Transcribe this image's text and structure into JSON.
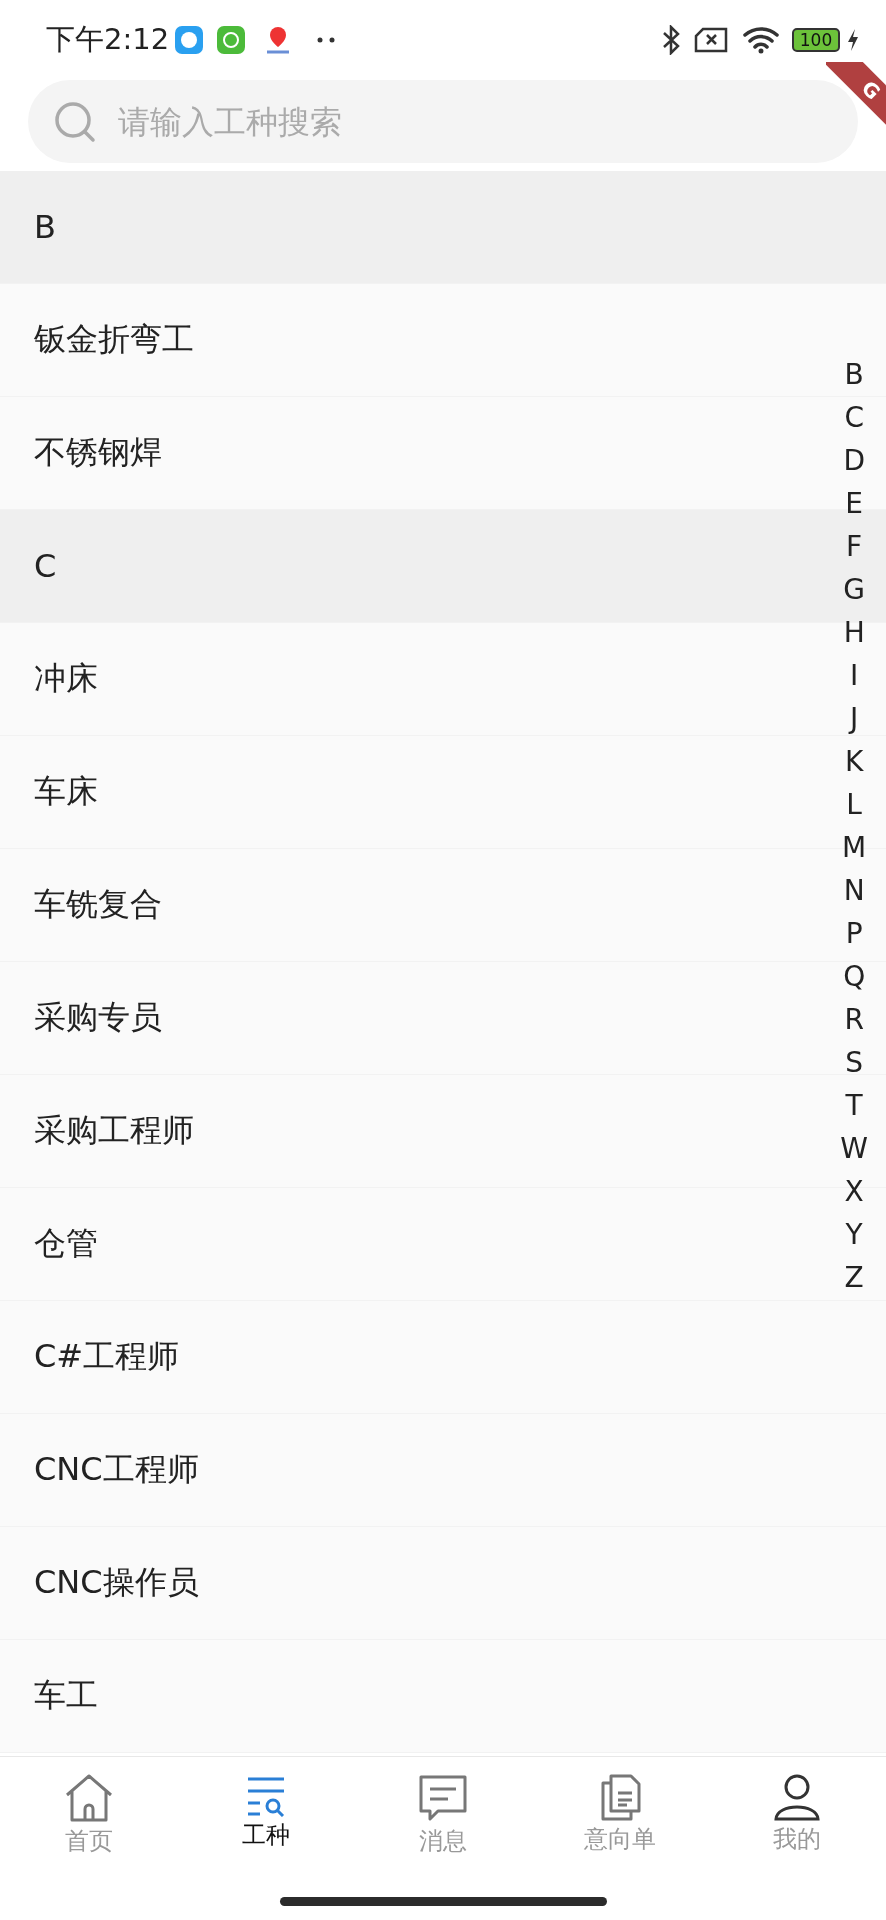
{
  "status_bar": {
    "time": "下午2:12",
    "battery": "100"
  },
  "debug_banner": {
    "label": "G"
  },
  "search": {
    "placeholder": "请输入工种搜索"
  },
  "list": [
    {
      "kind": "header",
      "label": "B"
    },
    {
      "kind": "item",
      "label": "钣金折弯工"
    },
    {
      "kind": "item",
      "label": "不锈钢焊"
    },
    {
      "kind": "header",
      "label": "C"
    },
    {
      "kind": "item",
      "label": "冲床"
    },
    {
      "kind": "item",
      "label": "车床"
    },
    {
      "kind": "item",
      "label": "车铣复合"
    },
    {
      "kind": "item",
      "label": "采购专员"
    },
    {
      "kind": "item",
      "label": "采购工程师"
    },
    {
      "kind": "item",
      "label": "仓管"
    },
    {
      "kind": "item",
      "label": "C#工程师"
    },
    {
      "kind": "item",
      "label": "CNC工程师"
    },
    {
      "kind": "item",
      "label": "CNC操作员"
    },
    {
      "kind": "item",
      "label": "车工"
    }
  ],
  "index": [
    "B",
    "C",
    "D",
    "E",
    "F",
    "G",
    "H",
    "I",
    "J",
    "K",
    "L",
    "M",
    "N",
    "P",
    "Q",
    "R",
    "S",
    "T",
    "W",
    "X",
    "Y",
    "Z"
  ],
  "tabs": [
    {
      "kind": "home",
      "label": "首页",
      "selected": false
    },
    {
      "kind": "trades",
      "label": "工种",
      "selected": true
    },
    {
      "kind": "messages",
      "label": "消息",
      "selected": false
    },
    {
      "kind": "orders",
      "label": "意向单",
      "selected": false
    },
    {
      "kind": "profile",
      "label": "我的",
      "selected": false
    }
  ]
}
